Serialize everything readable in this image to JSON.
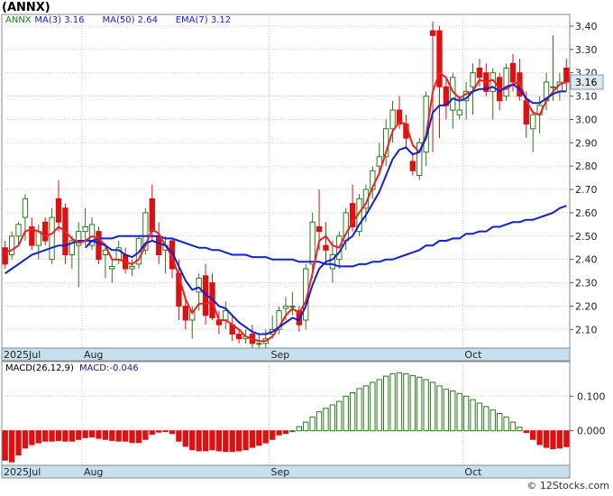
{
  "header": {
    "title": "(ANNX)"
  },
  "colors": {
    "up": "#2a7a1a",
    "down": "#dd1111",
    "ma3": "#ee2222",
    "ma50": "#1122cc",
    "ema7": "#1122cc",
    "macd_line": "#1a1aa0",
    "axis_bar": "#c7e0ee",
    "badge": "#dde8ee",
    "grid": "#cccccc"
  },
  "chart_data": [
    {
      "type": "candlestick",
      "title": "(ANNX)",
      "ylim": [
        2.02,
        3.45
      ],
      "ytick_labels": [
        "2.10",
        "2.20",
        "2.30",
        "2.40",
        "2.50",
        "2.60",
        "2.70",
        "2.80",
        "2.90",
        "3.00",
        "3.10",
        "3.20",
        "3.30",
        "3.40"
      ],
      "ytick_values": [
        2.1,
        2.2,
        2.3,
        2.4,
        2.5,
        2.6,
        2.7,
        2.8,
        2.9,
        3.0,
        3.1,
        3.2,
        3.3,
        3.4
      ],
      "x_labels": [
        {
          "text": "2025Jul",
          "index": 0
        },
        {
          "text": "Aug",
          "index": 12
        },
        {
          "text": "Sep",
          "index": 40
        },
        {
          "text": "Oct",
          "index": 69
        }
      ],
      "legend": [
        {
          "name": "ANNX",
          "value": ""
        },
        {
          "name": "MA(3)",
          "value": "3.16"
        },
        {
          "name": "MA(50)",
          "value": "2.64"
        },
        {
          "name": "EMA(7)",
          "value": "3.12"
        }
      ],
      "last_price_label": "3.16",
      "ohlc": [
        [
          2.45,
          2.48,
          2.36,
          2.38
        ],
        [
          2.42,
          2.52,
          2.4,
          2.5
        ],
        [
          2.5,
          2.56,
          2.46,
          2.55
        ],
        [
          2.58,
          2.68,
          2.48,
          2.66
        ],
        [
          2.54,
          2.58,
          2.44,
          2.46
        ],
        [
          2.46,
          2.55,
          2.4,
          2.52
        ],
        [
          2.56,
          2.58,
          2.46,
          2.48
        ],
        [
          2.4,
          2.62,
          2.38,
          2.58
        ],
        [
          2.66,
          2.74,
          2.52,
          2.56
        ],
        [
          2.62,
          2.64,
          2.38,
          2.42
        ],
        [
          2.42,
          2.5,
          2.36,
          2.48
        ],
        [
          2.46,
          2.56,
          2.28,
          2.52
        ],
        [
          2.52,
          2.62,
          2.46,
          2.54
        ],
        [
          2.46,
          2.58,
          2.44,
          2.55
        ],
        [
          2.52,
          2.54,
          2.38,
          2.4
        ],
        [
          2.42,
          2.47,
          2.32,
          2.44
        ],
        [
          2.36,
          2.4,
          2.3,
          2.37
        ],
        [
          2.4,
          2.48,
          2.38,
          2.45
        ],
        [
          2.42,
          2.45,
          2.34,
          2.36
        ],
        [
          2.36,
          2.4,
          2.33,
          2.37
        ],
        [
          2.38,
          2.5,
          2.36,
          2.49
        ],
        [
          2.44,
          2.62,
          2.42,
          2.6
        ],
        [
          2.66,
          2.72,
          2.48,
          2.52
        ],
        [
          2.5,
          2.56,
          2.38,
          2.42
        ],
        [
          2.44,
          2.5,
          2.34,
          2.46
        ],
        [
          2.48,
          2.49,
          2.32,
          2.36
        ],
        [
          2.34,
          2.4,
          2.14,
          2.2
        ],
        [
          2.2,
          2.24,
          2.1,
          2.14
        ],
        [
          2.14,
          2.2,
          2.06,
          2.18
        ],
        [
          2.26,
          2.34,
          2.18,
          2.32
        ],
        [
          2.33,
          2.38,
          2.12,
          2.16
        ],
        [
          2.3,
          2.34,
          2.14,
          2.15
        ],
        [
          2.14,
          2.18,
          2.08,
          2.12
        ],
        [
          2.14,
          2.22,
          2.1,
          2.18
        ],
        [
          2.12,
          2.16,
          2.05,
          2.08
        ],
        [
          2.08,
          2.1,
          2.04,
          2.06
        ],
        [
          2.06,
          2.1,
          2.04,
          2.07
        ],
        [
          2.08,
          2.12,
          2.02,
          2.04
        ],
        [
          2.04,
          2.08,
          2.02,
          2.04
        ],
        [
          2.04,
          2.1,
          2.02,
          2.06
        ],
        [
          2.08,
          2.16,
          2.06,
          2.1
        ],
        [
          2.1,
          2.2,
          2.08,
          2.18
        ],
        [
          2.19,
          2.24,
          2.14,
          2.2
        ],
        [
          2.2,
          2.26,
          2.16,
          2.2
        ],
        [
          2.18,
          2.2,
          2.09,
          2.12
        ],
        [
          2.14,
          2.38,
          2.1,
          2.36
        ],
        [
          2.38,
          2.6,
          2.32,
          2.56
        ],
        [
          2.54,
          2.7,
          2.44,
          2.52
        ],
        [
          2.46,
          2.56,
          2.38,
          2.44
        ],
        [
          2.36,
          2.48,
          2.3,
          2.42
        ],
        [
          2.4,
          2.52,
          2.36,
          2.5
        ],
        [
          2.48,
          2.62,
          2.44,
          2.6
        ],
        [
          2.64,
          2.72,
          2.52,
          2.54
        ],
        [
          2.52,
          2.68,
          2.5,
          2.66
        ],
        [
          2.62,
          2.72,
          2.56,
          2.7
        ],
        [
          2.7,
          2.8,
          2.66,
          2.78
        ],
        [
          2.8,
          2.9,
          2.76,
          2.84
        ],
        [
          2.84,
          3.0,
          2.8,
          2.96
        ],
        [
          2.96,
          3.08,
          2.9,
          3.04
        ],
        [
          3.04,
          3.1,
          2.96,
          2.98
        ],
        [
          2.98,
          3.02,
          2.88,
          2.92
        ],
        [
          2.82,
          2.86,
          2.76,
          2.78
        ],
        [
          2.76,
          2.92,
          2.74,
          2.9
        ],
        [
          2.86,
          3.12,
          2.8,
          3.1
        ],
        [
          3.38,
          3.42,
          2.86,
          3.36
        ],
        [
          3.38,
          3.4,
          2.92,
          3.14
        ],
        [
          3.14,
          3.18,
          3.0,
          3.06
        ],
        [
          3.04,
          3.2,
          2.96,
          3.18
        ],
        [
          3.02,
          3.1,
          3.0,
          3.04
        ],
        [
          3.08,
          3.16,
          3.0,
          3.12
        ],
        [
          3.14,
          3.24,
          3.02,
          3.2
        ],
        [
          3.22,
          3.26,
          3.14,
          3.18
        ],
        [
          3.2,
          3.24,
          3.1,
          3.12
        ],
        [
          3.12,
          3.22,
          3.0,
          3.2
        ],
        [
          3.18,
          3.2,
          3.04,
          3.08
        ],
        [
          3.1,
          3.24,
          3.08,
          3.22
        ],
        [
          3.24,
          3.28,
          3.12,
          3.16
        ],
        [
          3.2,
          3.26,
          3.08,
          3.1
        ],
        [
          3.08,
          3.12,
          2.92,
          2.98
        ],
        [
          2.96,
          3.04,
          2.86,
          3.02
        ],
        [
          3.02,
          3.1,
          2.94,
          3.06
        ],
        [
          3.08,
          3.2,
          3.04,
          3.16
        ],
        [
          3.14,
          3.36,
          3.08,
          3.14
        ],
        [
          3.12,
          3.2,
          3.08,
          3.16
        ],
        [
          3.22,
          3.26,
          3.12,
          3.16
        ]
      ],
      "ma3": [
        2.43,
        2.44,
        2.46,
        2.52,
        2.53,
        2.52,
        2.5,
        2.51,
        2.54,
        2.52,
        2.49,
        2.47,
        2.48,
        2.5,
        2.49,
        2.46,
        2.4,
        2.4,
        2.39,
        2.38,
        2.4,
        2.46,
        2.53,
        2.51,
        2.46,
        2.41,
        2.33,
        2.23,
        2.17,
        2.21,
        2.21,
        2.22,
        2.14,
        2.14,
        2.12,
        2.1,
        2.07,
        2.06,
        2.05,
        2.05,
        2.07,
        2.11,
        2.16,
        2.19,
        2.17,
        2.22,
        2.34,
        2.48,
        2.5,
        2.46,
        2.45,
        2.51,
        2.56,
        2.6,
        2.64,
        2.71,
        2.77,
        2.86,
        2.95,
        2.99,
        2.98,
        2.89,
        2.86,
        2.93,
        3.12,
        3.2,
        3.18,
        3.12,
        3.09,
        3.11,
        3.12,
        3.17,
        3.16,
        3.17,
        3.13,
        3.13,
        3.15,
        3.16,
        3.08,
        3.03,
        3.02,
        3.08,
        3.12,
        3.15,
        3.16
      ],
      "ema7": [
        null,
        null,
        null,
        null,
        null,
        null,
        null,
        null,
        null,
        null,
        null,
        null,
        2.45,
        2.48,
        2.47,
        2.46,
        2.44,
        2.44,
        2.42,
        2.41,
        2.43,
        2.47,
        2.48,
        2.47,
        2.46,
        2.43,
        2.37,
        2.31,
        2.27,
        2.28,
        2.25,
        2.23,
        2.2,
        2.19,
        2.16,
        2.13,
        2.11,
        2.09,
        2.08,
        2.08,
        2.09,
        2.11,
        2.13,
        2.15,
        2.14,
        2.2,
        2.29,
        2.36,
        2.39,
        2.4,
        2.43,
        2.48,
        2.5,
        2.55,
        2.59,
        2.64,
        2.69,
        2.76,
        2.83,
        2.87,
        2.88,
        2.85,
        2.86,
        2.92,
        3.03,
        3.06,
        3.06,
        3.09,
        3.08,
        3.09,
        3.12,
        3.13,
        3.13,
        3.14,
        3.12,
        3.14,
        3.15,
        3.13,
        3.09,
        3.07,
        3.07,
        3.09,
        3.11,
        3.12,
        3.12
      ],
      "ma50": [
        2.34,
        2.36,
        2.38,
        2.4,
        2.42,
        2.43,
        2.44,
        2.45,
        2.46,
        2.46,
        2.47,
        2.48,
        2.48,
        2.48,
        2.49,
        2.49,
        2.49,
        2.5,
        2.5,
        2.5,
        2.5,
        2.5,
        2.5,
        2.5,
        2.49,
        2.49,
        2.48,
        2.47,
        2.46,
        2.45,
        2.45,
        2.44,
        2.44,
        2.43,
        2.42,
        2.42,
        2.42,
        2.41,
        2.41,
        2.41,
        2.4,
        2.4,
        2.4,
        2.4,
        2.39,
        2.39,
        2.39,
        2.39,
        2.38,
        2.38,
        2.37,
        2.37,
        2.37,
        2.38,
        2.38,
        2.39,
        2.39,
        2.4,
        2.4,
        2.41,
        2.42,
        2.43,
        2.44,
        2.46,
        2.46,
        2.48,
        2.48,
        2.49,
        2.49,
        2.51,
        2.51,
        2.52,
        2.52,
        2.54,
        2.54,
        2.55,
        2.56,
        2.56,
        2.57,
        2.57,
        2.58,
        2.59,
        2.6,
        2.62,
        2.63
      ]
    },
    {
      "type": "bar",
      "title": "MACD(26,12,9)",
      "legend": [
        {
          "name": "MACD(26,12,9)",
          "value": ""
        },
        {
          "name": "MACD:",
          "value": "-0.046"
        }
      ],
      "ylim": [
        -0.1,
        0.2
      ],
      "ytick_labels": [
        "0.000",
        "0.100"
      ],
      "ytick_values": [
        0.0,
        0.1
      ],
      "values": [
        -0.085,
        -0.09,
        -0.07,
        -0.05,
        -0.04,
        -0.035,
        -0.03,
        -0.03,
        -0.028,
        -0.03,
        -0.03,
        -0.025,
        -0.02,
        -0.018,
        -0.022,
        -0.025,
        -0.028,
        -0.03,
        -0.03,
        -0.034,
        -0.034,
        -0.025,
        -0.01,
        -0.004,
        -0.002,
        -0.008,
        -0.03,
        -0.045,
        -0.055,
        -0.058,
        -0.058,
        -0.055,
        -0.058,
        -0.06,
        -0.06,
        -0.058,
        -0.055,
        -0.048,
        -0.042,
        -0.035,
        -0.025,
        -0.012,
        -0.008,
        0.0,
        0.012,
        0.025,
        0.04,
        0.055,
        0.065,
        0.075,
        0.085,
        0.1,
        0.11,
        0.122,
        0.13,
        0.14,
        0.148,
        0.158,
        0.165,
        0.168,
        0.165,
        0.16,
        0.155,
        0.148,
        0.14,
        0.13,
        0.12,
        0.115,
        0.108,
        0.1,
        0.09,
        0.08,
        0.07,
        0.06,
        0.05,
        0.04,
        0.025,
        0.01,
        -0.005,
        -0.025,
        -0.04,
        -0.048,
        -0.052,
        -0.05,
        -0.046
      ]
    }
  ],
  "footer": {
    "copyright": "© 12Stocks.com"
  }
}
